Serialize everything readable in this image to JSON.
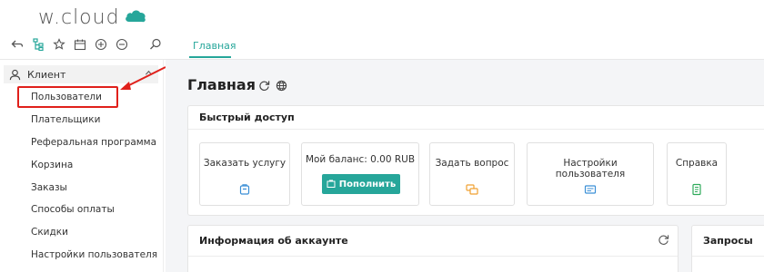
{
  "app": {
    "logo_text": "w.cloud",
    "brand_color": "#26a69a"
  },
  "toolbar": {
    "icons": [
      "back-icon",
      "sitemap-icon",
      "star-icon",
      "calendar-icon",
      "add-circle-icon",
      "remove-circle-icon",
      "search-icon"
    ]
  },
  "tabs": [
    {
      "label": "Главная",
      "active": true
    }
  ],
  "sidebar": {
    "section_label": "Клиент",
    "items": [
      {
        "label": "Пользователи",
        "highlighted": true
      },
      {
        "label": "Плательщики"
      },
      {
        "label": "Реферальная программа"
      },
      {
        "label": "Корзина"
      },
      {
        "label": "Заказы"
      },
      {
        "label": "Способы оплаты"
      },
      {
        "label": "Скидки"
      },
      {
        "label": "Настройки пользователя"
      }
    ]
  },
  "main": {
    "title": "Главная",
    "quick_access": {
      "title": "Быстрый доступ",
      "tiles": [
        {
          "label": "Заказать услугу",
          "icon": "order-icon",
          "icon_color": "#3b8fd6"
        },
        {
          "label": "Мой баланс: 0.00 RUB",
          "button_label": "Пополнить"
        },
        {
          "label": "Задать вопрос",
          "icon": "chat-icon",
          "icon_color": "#f0a030"
        },
        {
          "label": "Настройки пользователя",
          "icon": "settings-card-icon",
          "icon_color": "#3b8fd6"
        },
        {
          "label": "Справка",
          "icon": "help-doc-icon",
          "icon_color": "#2eaa5a"
        }
      ]
    },
    "account_info": {
      "title": "Информация об аккаунте"
    },
    "requests": {
      "title": "Запросы"
    }
  }
}
